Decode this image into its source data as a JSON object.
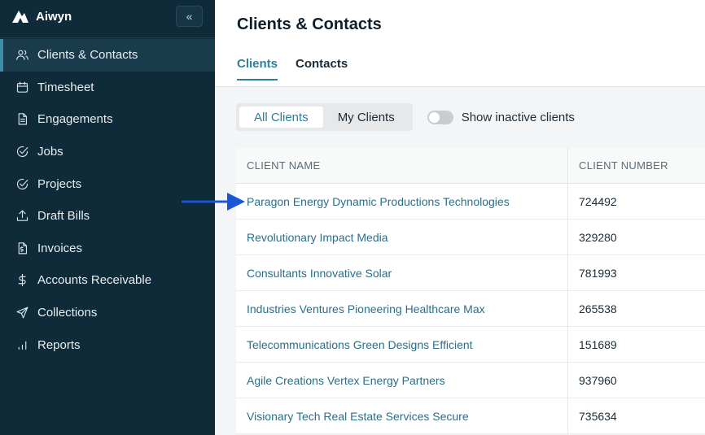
{
  "app": {
    "name": "Aiwyn",
    "collapse_glyph": "«"
  },
  "sidebar": {
    "items": [
      {
        "label": "Clients & Contacts",
        "icon": "users-icon",
        "active": true
      },
      {
        "label": "Timesheet",
        "icon": "calendar-icon",
        "active": false
      },
      {
        "label": "Engagements",
        "icon": "document-icon",
        "active": false
      },
      {
        "label": "Jobs",
        "icon": "check-circle-icon",
        "active": false
      },
      {
        "label": "Projects",
        "icon": "check-circle-icon",
        "active": false
      },
      {
        "label": "Draft Bills",
        "icon": "upload-icon",
        "active": false
      },
      {
        "label": "Invoices",
        "icon": "invoice-icon",
        "active": false
      },
      {
        "label": "Accounts Receivable",
        "icon": "dollar-icon",
        "active": false
      },
      {
        "label": "Collections",
        "icon": "send-icon",
        "active": false
      },
      {
        "label": "Reports",
        "icon": "bar-chart-icon",
        "active": false
      }
    ]
  },
  "header": {
    "title": "Clients & Contacts",
    "tabs": [
      {
        "label": "Clients",
        "active": true
      },
      {
        "label": "Contacts",
        "active": false
      }
    ]
  },
  "filters": {
    "segments": [
      {
        "label": "All Clients",
        "active": true
      },
      {
        "label": "My Clients",
        "active": false
      }
    ],
    "toggle_label": "Show inactive clients",
    "toggle_on": false
  },
  "table": {
    "columns": [
      "CLIENT NAME",
      "CLIENT NUMBER"
    ],
    "rows": [
      {
        "name": "Paragon Energy Dynamic Productions Technologies",
        "number": "724492"
      },
      {
        "name": "Revolutionary Impact Media",
        "number": "329280"
      },
      {
        "name": "Consultants Innovative Solar",
        "number": "781993"
      },
      {
        "name": "Industries Ventures Pioneering Healthcare Max",
        "number": "265538"
      },
      {
        "name": "Telecommunications Green Designs Efficient",
        "number": "151689"
      },
      {
        "name": "Agile Creations Vertex Energy Partners",
        "number": "937960"
      },
      {
        "name": "Visionary Tech Real Estate Services Secure",
        "number": "735634"
      }
    ]
  },
  "colors": {
    "sidebar_bg": "#0f2b3a",
    "accent": "#2f7f9a",
    "annotation_arrow": "#1a56d6"
  }
}
